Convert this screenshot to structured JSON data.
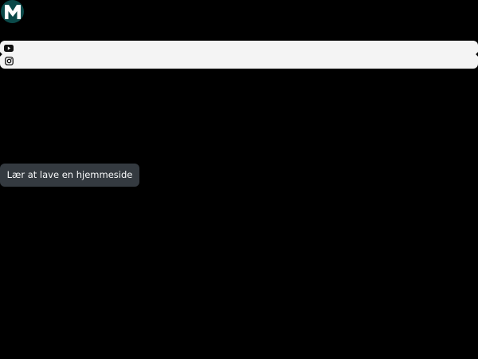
{
  "logo": {
    "letter": "M",
    "bg_color": "#0b4a4a",
    "fg_color": "#ffffff"
  },
  "social": {
    "icons": [
      "youtube-icon",
      "instagram-icon"
    ],
    "bar_color": "#f4f4f4"
  },
  "cta": {
    "label": "Lær at lave en hjemmeside",
    "bg_color": "#343a40",
    "text_color": "#f8f9fa"
  }
}
